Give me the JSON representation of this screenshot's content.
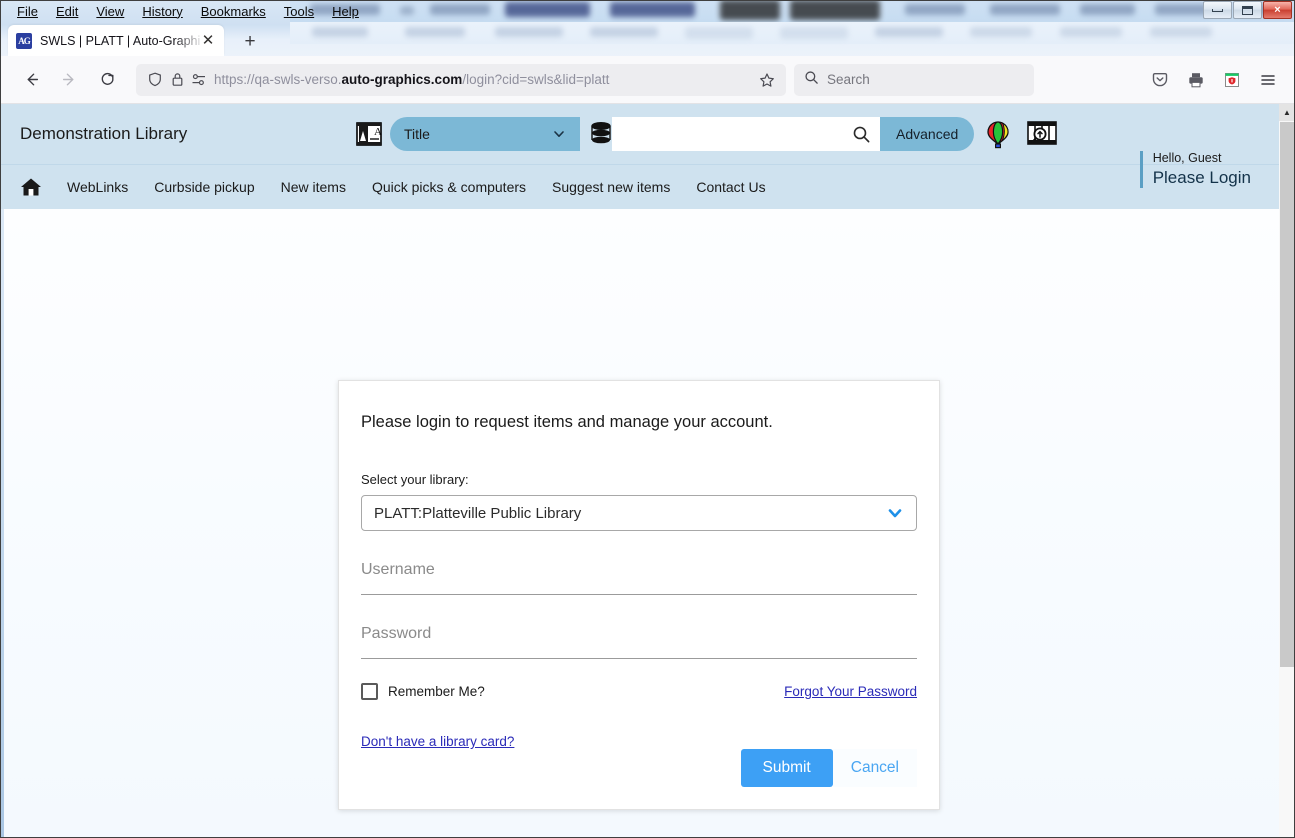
{
  "window": {
    "menus": [
      "File",
      "Edit",
      "View",
      "History",
      "Bookmarks",
      "Tools",
      "Help"
    ],
    "controls": {
      "minimize": "minimize",
      "restore": "restore",
      "close": "×"
    }
  },
  "tab": {
    "title": "SWLS | PLATT | Auto-Graphics In",
    "favicon": "ag-logo-icon",
    "close_label": "✕",
    "newtab_label": "+"
  },
  "toolbar": {
    "back_icon": "back-arrow-icon",
    "forward_icon": "forward-arrow-icon",
    "reload_icon": "reload-icon",
    "shield_icon": "shield-icon",
    "lock_icon": "padlock-icon",
    "permissions_icon": "permissions-icon",
    "url_prefix": "https://qa-swls-verso.",
    "url_domain": "auto-graphics.com",
    "url_suffix": "/login?cid=swls&lid=platt",
    "bookmark_icon": "star-icon",
    "search_placeholder": "Search",
    "search_icon": "search-icon",
    "pocket_icon": "pocket-icon",
    "print_icon": "print-icon",
    "extension_icon": "extension-icon",
    "menu_icon": "hamburger-menu-icon"
  },
  "site_header": {
    "library_name": "Demonstration Library",
    "language_icon": "translate-icon",
    "scope_value": "Title",
    "scope_chevron": "chevron-down-icon",
    "database_icon": "database-stack-icon",
    "search_value": "",
    "search_placeholder": "",
    "search_icon": "search-icon",
    "advanced_label": "Advanced",
    "balloon_icon": "hot-air-balloon-icon",
    "browse_icon": "browse-shelf-search-icon",
    "listview_icon": "list-view-icon"
  },
  "site_nav": {
    "home_icon": "home-icon",
    "links": [
      "WebLinks",
      "Curbside pickup",
      "New items",
      "Quick picks & computers",
      "Suggest new items",
      "Contact Us"
    ],
    "greeting": "Hello, Guest",
    "login_prompt": "Please Login"
  },
  "login_card": {
    "heading": "Please login to request items and manage your account.",
    "library_label": "Select your library:",
    "library_selected": "PLATT:Platteville Public Library",
    "library_chevron": "chevron-down-icon",
    "username_placeholder": "Username",
    "username_value": "",
    "password_placeholder": "Password",
    "password_value": "",
    "remember_label": "Remember Me?",
    "remember_checked": false,
    "forgot_password_label": "Forgot Your Password",
    "no_card_label": "Don't have a library card?",
    "submit_label": "Submit",
    "cancel_label": "Cancel"
  },
  "scrollbar": {
    "up_arrow": "▲"
  },
  "colors": {
    "header_blue": "#cfe2ef",
    "pill_blue": "#7cb8d6",
    "submit_blue": "#3da0f5",
    "link_blue": "#2a2ab8",
    "cancel_blue": "#4aa6f2",
    "accent_divider": "#5b9fc4"
  }
}
